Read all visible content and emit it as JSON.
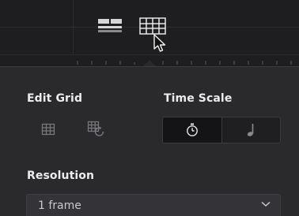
{
  "toolbar": {
    "view_buttons": [
      {
        "icon": "stacked-layout-icon",
        "active": false
      },
      {
        "icon": "grid-view-icon",
        "active": true
      }
    ]
  },
  "panel": {
    "edit_grid": {
      "label": "Edit Grid",
      "buttons": [
        {
          "icon": "grid-icon"
        },
        {
          "icon": "grid-refresh-icon"
        }
      ]
    },
    "time_scale": {
      "label": "Time Scale",
      "options": [
        {
          "icon": "stopwatch-icon",
          "selected": true
        },
        {
          "icon": "music-note-icon",
          "selected": false
        }
      ]
    },
    "resolution": {
      "label": "Resolution",
      "value": "1 frame"
    }
  },
  "colors": {
    "background": "#1b1b1d",
    "panel": "#2a2a2d",
    "text": "#ececec",
    "icon_dim": "#7a7a7e"
  }
}
